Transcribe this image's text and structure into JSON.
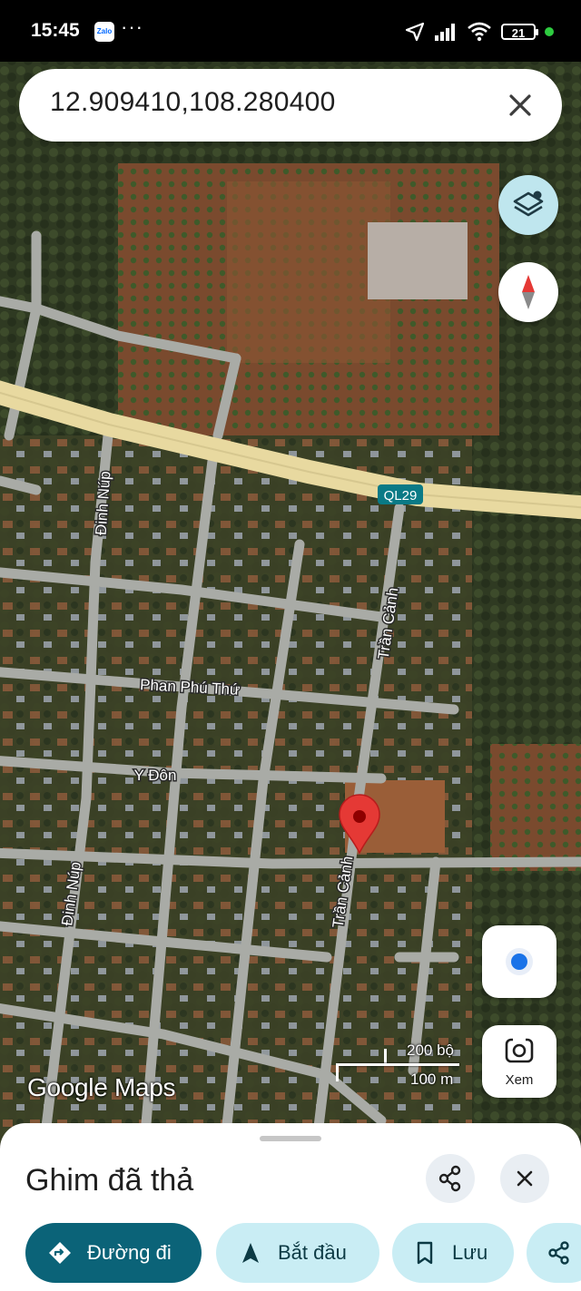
{
  "status_bar": {
    "time": "15:45",
    "app_badge": "Zalo",
    "overflow": "···",
    "battery_level": "21"
  },
  "search": {
    "query": "12.909410,108.280400",
    "icons": [
      "close-icon"
    ]
  },
  "map": {
    "road_labels": {
      "highway": "QL29",
      "dinh_nup_top": "Đinh Núp",
      "dinh_nup_bottom": "Đinh Núp",
      "tran_canh_top": "Trần Cảnh",
      "tran_canh_bottom": "Trần Cảnh",
      "phan_phu_thu": "Phan Phú Thứ",
      "y_don": "Y Đôn"
    },
    "scale": {
      "imperial": "200 bộ",
      "metric": "100 m"
    },
    "attribution": "Google Maps",
    "view_button_label": "Xem",
    "colors": {
      "pin": "#e53935",
      "highway": "#e8d9a0",
      "road": "#a9aba6",
      "locate_dot": "#1a73e8"
    }
  },
  "sheet": {
    "title": "Ghim đã thả",
    "actions": {
      "directions": "Đường đi",
      "start": "Bắt đầu",
      "save": "Lưu"
    }
  }
}
